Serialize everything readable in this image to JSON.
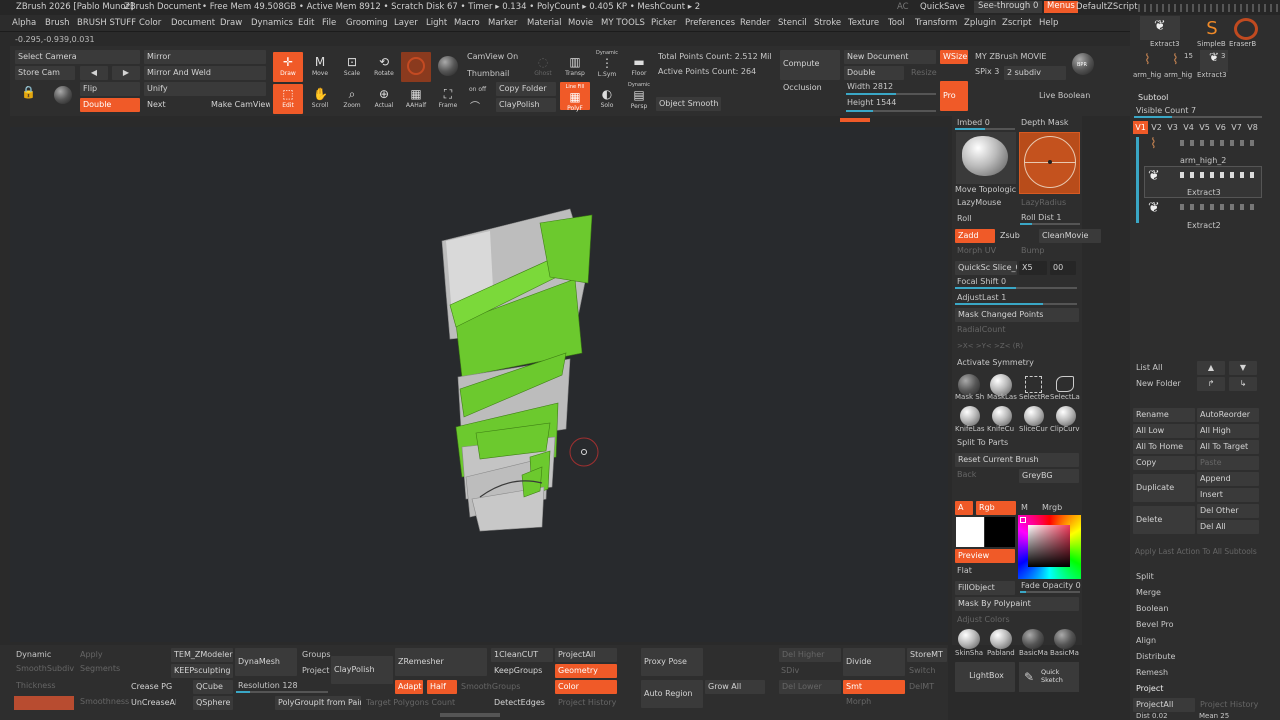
{
  "titlebar": {
    "app": "ZBrush 2026 [Pablo Munoz]",
    "doc": "ZBrush Document",
    "stats": "• Free Mem 49.508GB • Active Mem 8912 • Scratch Disk 67 • Timer ▸ 0.134 • PolyCount ▸ 0.405 KP • MeshCount ▸ 2",
    "ac": "AC",
    "quicksave": "QuickSave",
    "seethrough": "See-through 0",
    "menus": "Menus",
    "script": "DefaultZScript"
  },
  "menu": [
    "Alpha",
    "Brush",
    "BRUSH STUFF",
    "Color",
    "Document",
    "Draw",
    "Dynamics",
    "Edit",
    "File",
    "Grooming",
    "Layer",
    "Light",
    "Macro",
    "Marker",
    "Material",
    "Movie",
    "MY TOOLS",
    "Picker",
    "Preferences",
    "Render",
    "Stencil",
    "Stroke",
    "Texture",
    "Tool",
    "Transform",
    "Zplugin",
    "Zscript",
    "Help"
  ],
  "coords": "-0.295,-0.939,0.031",
  "toolbar": {
    "select_camera": "Select Camera",
    "store_cam": "Store Cam",
    "mirror": "Mirror",
    "mirror_weld": "Mirror And Weld",
    "flip": "Flip",
    "unify": "Unify",
    "double": "Double",
    "next": "Next",
    "make_camview": "Make CamView",
    "draw": "Draw",
    "move": "Move",
    "scale": "Scale",
    "rotate": "Rotate",
    "edit": "Edit",
    "scroll": "Scroll",
    "zoom": "Zoom",
    "actual": "Actual",
    "aahalf": "AAHalf",
    "frame": "Frame",
    "camview_on": "CamView On",
    "thumbnail": "Thumbnail",
    "onoff": "on  off",
    "copy_folder": "Copy Folder",
    "claypolish": "ClayPolish",
    "ghost": "Ghost",
    "transp": "Transp",
    "dynamic": "Dynamic",
    "lsym": "L.Sym",
    "floor": "Floor",
    "linefill": "Line Fill",
    "polyf": "PolyF",
    "solo": "Solo",
    "persp": "Persp",
    "dynamic2": "Dynamic",
    "object_smooth": "Object Smooth",
    "total_points": "Total Points Count: 2.512 Mil",
    "active_points": "Active Points Count: 264",
    "compute": "Compute",
    "occlusion": "Occlusion",
    "new_document": "New Document",
    "double2": "Double",
    "resize": "Resize",
    "wsize": "WSize",
    "width": "Width 2812",
    "height": "Height 1544",
    "movie": "MY ZBrush MOVIE",
    "spix": "SPix 3",
    "subdiv": "2 subdiv",
    "pro": "Pro",
    "bpr": "BPR",
    "live_boolean": "Live Boolean"
  },
  "right": {
    "imbed": "Imbed 0",
    "depth_mask": "Depth Mask",
    "move_topo": "Move Topologic",
    "lazymouse": "LazyMouse",
    "lazyradius": "LazyRadius",
    "roll": "Roll",
    "roll_dist": "Roll Dist 1",
    "zadd": "Zadd",
    "zsub": "Zsub",
    "cleanmovie": "CleanMovie",
    "morph_uv": "Morph UV",
    "bump": "Bump",
    "quicksave_slice": "QuickSc Slice_Cu",
    "x5": "X5",
    "zero0": "00",
    "focal": "Focal Shift 0",
    "adjustlast": "AdjustLast 1",
    "mask_changed": "Mask Changed Points",
    "radialcount": "RadialCount",
    "xyz": ">X<   >Y<   >Z<   (R)",
    "activate_sym": "Activate Symmetry",
    "brushes": [
      "Mask Sh",
      "MaskLas",
      "SelectRe",
      "SelectLa",
      "KnifeLas",
      "KnifeCu",
      "SliceCur",
      "ClipCurv"
    ],
    "split_parts": "Split To Parts",
    "reset_brush": "Reset Current Brush",
    "back": "Back",
    "greybg": "GreyBG",
    "a": "A",
    "rgb": "Rgb",
    "m": "M",
    "mrgb": "Mrgb",
    "preview": "Preview",
    "flat": "Flat",
    "fillobject": "FillObject",
    "fade_opacity": "Fade Opacity 0",
    "mask_polypaint": "Mask By Polypaint",
    "adjust_colors": "Adjust Colors",
    "materials": [
      "SkinSha",
      "Pabland",
      "BasicMa",
      "BasicMa"
    ],
    "lightbox": "LightBox",
    "quick_sketch": "Quick Sketch"
  },
  "subtool": {
    "thumbs": [
      "Extract3",
      "SimpleB",
      "EraserB",
      "arm_hig",
      "arm_hig",
      "Extract3"
    ],
    "thumb_badge": "15",
    "thumb_badge2": "3",
    "header": "Subtool",
    "visible_count": "Visible Count 7",
    "versions": [
      "V1",
      "V2",
      "V3",
      "V4",
      "V5",
      "V6",
      "V7",
      "V8"
    ],
    "items": [
      "arm_high_2",
      "Extract3",
      "Extract2"
    ],
    "list_all": "List All",
    "new_folder": "New Folder",
    "rename": "Rename",
    "autoreorder": "AutoReorder",
    "all_low": "All Low",
    "all_high": "All High",
    "all_home": "All To Home",
    "all_target": "All To Target",
    "copy": "Copy",
    "paste": "Paste",
    "duplicate": "Duplicate",
    "append": "Append",
    "insert": "Insert",
    "delete": "Delete",
    "del_other": "Del Other",
    "del_all": "Del All",
    "apply_last": "Apply Last Action To All Subtools",
    "split": "Split",
    "merge": "Merge",
    "boolean": "Boolean",
    "bevel_pro": "Bevel Pro",
    "align": "Align",
    "distribute": "Distribute",
    "remesh": "Remesh",
    "project": "Project",
    "projectall": "ProjectAll",
    "project_history": "Project History",
    "dist": "Dist 0.02",
    "mean": "Mean 25"
  },
  "bottom": {
    "dynamic": "Dynamic",
    "apply": "Apply",
    "smoothsubdiv": "SmoothSubdiv",
    "segments": "Segments",
    "thickness": "Thickness",
    "smoothness": "Smoothness",
    "crease_pg": "Crease PG",
    "uncreaseall": "UnCreaseAll",
    "tem_zmodeler": "TEM_ZModeler",
    "keepsculpting": "KEEPsculpting",
    "qcube": "QCube",
    "qsphere": "QSphere",
    "dynamesh": "DynaMesh",
    "resolution": "Resolution 128",
    "groups": "Groups",
    "project": "Project",
    "claypolish": "ClayPolish",
    "polygroupit": "PolyGroupIt from Paint",
    "zremesher": "ZRemesher",
    "adapt": "Adapt",
    "half": "Half",
    "smoothgroups": "SmoothGroups",
    "target_poly": "Target Polygons Count",
    "onecleancut": "1CleanCUT",
    "keepgroups": "KeepGroups",
    "detectedges": "DetectEdges",
    "projectall": "ProjectAll",
    "geometry": "Geometry",
    "color": "Color",
    "project_history": "Project History",
    "proxy_pose": "Proxy Pose",
    "auto_region": "Auto Region",
    "grow_all": "Grow All",
    "del_higher": "Del Higher",
    "sdiv": "SDiv",
    "del_lower": "Del Lower",
    "divide": "Divide",
    "smt": "Smt",
    "morph": "Morph",
    "storemt": "StoreMT",
    "switch": "Switch",
    "delmt": "DelMT"
  },
  "colors": {
    "accent": "#f05a28",
    "slider": "#3aa7c6",
    "mesh_green": "#6cc92e",
    "bg": "#282a2d"
  }
}
